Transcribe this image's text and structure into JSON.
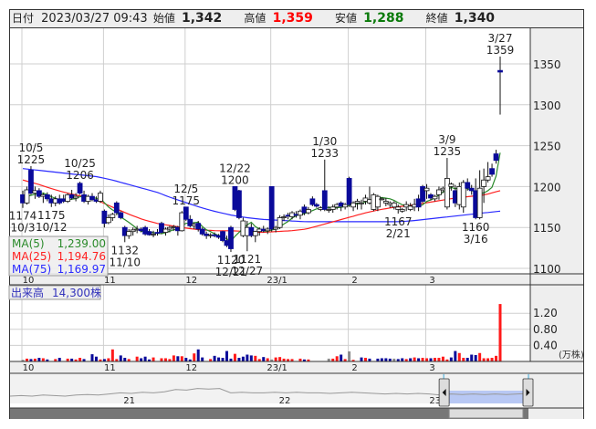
{
  "header": {
    "date_label": "日付",
    "date_value": "2023/03/27 09:43",
    "open_label": "始値",
    "open_value": "1,342",
    "high_label": "高値",
    "high_value": "1,359",
    "low_label": "安値",
    "low_value": "1,288",
    "close_label": "終値",
    "close_value": "1,340"
  },
  "colors": {
    "up_volume": "#ff1a1a",
    "down_volume": "#0a0a9a",
    "flat_volume": "#8c8c8c",
    "ma5": "#2a8a2a",
    "ma25": "#ff2020",
    "ma75": "#2a2aff",
    "high_text": "#ff0000",
    "low_text": "#0a7a0a"
  },
  "legend": [
    {
      "name": "MA(5)",
      "value": "1,239.00"
    },
    {
      "name": "MA(25)",
      "value": "1,194.76"
    },
    {
      "name": "MA(75)",
      "value": "1,169.97"
    }
  ],
  "volume_label": {
    "name": "出来高",
    "value": "14,300株"
  },
  "volume_unit": "(万株)",
  "chart_data": {
    "type": "candlestick",
    "price_axis": {
      "min": 1090,
      "max": 1385,
      "ticks": [
        1100,
        1150,
        1200,
        1250,
        1300,
        1350
      ]
    },
    "volume_axis": {
      "ticks": [
        "0.40",
        "0.80",
        "1.20"
      ],
      "tick_values": [
        0.4,
        0.8,
        1.2
      ]
    },
    "months": [
      {
        "label": "10",
        "index": 0
      },
      {
        "label": "11",
        "index": 20
      },
      {
        "label": "12",
        "index": 40
      },
      {
        "label": "23/1",
        "index": 61
      },
      {
        "label": "2",
        "index": 80
      },
      {
        "label": "3",
        "index": 99
      }
    ],
    "candles": [
      [
        1190,
        1195,
        1174,
        1180
      ],
      [
        1180,
        1200,
        1178,
        1196
      ],
      [
        1220,
        1225,
        1190,
        1192
      ],
      [
        1192,
        1200,
        1185,
        1195
      ],
      [
        1195,
        1198,
        1186,
        1188
      ],
      [
        1188,
        1192,
        1180,
        1190
      ],
      [
        1190,
        1193,
        1182,
        1185
      ],
      [
        1185,
        1190,
        1175,
        1180
      ],
      [
        1180,
        1188,
        1176,
        1185
      ],
      [
        1185,
        1190,
        1178,
        1180
      ],
      [
        1185,
        1190,
        1180,
        1182
      ],
      [
        1182,
        1192,
        1180,
        1190
      ],
      [
        1190,
        1196,
        1184,
        1186
      ],
      [
        1186,
        1192,
        1182,
        1188
      ],
      [
        1204,
        1206,
        1190,
        1192
      ],
      [
        1190,
        1195,
        1180,
        1182
      ],
      [
        1182,
        1190,
        1178,
        1188
      ],
      [
        1188,
        1192,
        1182,
        1184
      ],
      [
        1184,
        1188,
        1180,
        1182
      ],
      [
        1182,
        1195,
        1180,
        1192
      ],
      [
        1170,
        1172,
        1150,
        1155
      ],
      [
        1156,
        1166,
        1154,
        1162
      ],
      [
        1162,
        1168,
        1158,
        1166
      ],
      [
        1180,
        1182,
        1165,
        1168
      ],
      [
        1168,
        1170,
        1160,
        1162
      ],
      [
        1150,
        1152,
        1132,
        1140
      ],
      [
        1140,
        1148,
        1136,
        1145
      ],
      [
        1145,
        1150,
        1140,
        1147
      ],
      [
        1147,
        1152,
        1143,
        1148
      ],
      [
        1148,
        1150,
        1144,
        1146
      ],
      [
        1150,
        1152,
        1140,
        1142
      ],
      [
        1145,
        1148,
        1140,
        1141
      ],
      [
        1142,
        1146,
        1138,
        1142
      ],
      [
        1144,
        1148,
        1140,
        1143
      ],
      [
        1155,
        1157,
        1142,
        1144
      ],
      [
        1144,
        1150,
        1140,
        1148
      ],
      [
        1148,
        1152,
        1144,
        1150
      ],
      [
        1150,
        1153,
        1146,
        1151
      ],
      [
        1150,
        1152,
        1140,
        1146
      ],
      [
        1146,
        1170,
        1145,
        1168
      ],
      [
        1175,
        1175,
        1158,
        1160
      ],
      [
        1160,
        1165,
        1150,
        1152
      ],
      [
        1152,
        1156,
        1148,
        1154
      ],
      [
        1155,
        1158,
        1145,
        1148
      ],
      [
        1148,
        1150,
        1140,
        1142
      ],
      [
        1142,
        1145,
        1136,
        1140
      ],
      [
        1140,
        1143,
        1137,
        1141
      ],
      [
        1141,
        1144,
        1138,
        1140
      ],
      [
        1140,
        1142,
        1136,
        1138
      ],
      [
        1145,
        1146,
        1132,
        1134
      ],
      [
        1134,
        1140,
        1126,
        1128
      ],
      [
        1150,
        1152,
        1120,
        1124
      ],
      [
        1200,
        1200,
        1170,
        1172
      ],
      [
        1195,
        1196,
        1160,
        1162
      ],
      [
        1140,
        1162,
        1138,
        1158
      ],
      [
        1140,
        1158,
        1121,
        1150
      ],
      [
        1150,
        1155,
        1138,
        1140
      ],
      [
        1140,
        1146,
        1132,
        1145
      ],
      [
        1145,
        1150,
        1140,
        1148
      ],
      [
        1148,
        1152,
        1144,
        1146
      ],
      [
        1146,
        1150,
        1142,
        1148
      ],
      [
        1200,
        1200,
        1145,
        1148
      ],
      [
        1148,
        1152,
        1144,
        1150
      ],
      [
        1150,
        1165,
        1148,
        1162
      ],
      [
        1162,
        1166,
        1158,
        1163
      ],
      [
        1165,
        1168,
        1160,
        1164
      ],
      [
        1163,
        1170,
        1160,
        1168
      ],
      [
        1166,
        1170,
        1162,
        1165
      ],
      [
        1165,
        1172,
        1160,
        1170
      ],
      [
        1175,
        1178,
        1165,
        1168
      ],
      [
        1168,
        1175,
        1166,
        1172
      ],
      [
        1185,
        1188,
        1176,
        1178
      ],
      [
        1178,
        1180,
        1174,
        1176
      ],
      [
        1172,
        1176,
        1170,
        1174
      ],
      [
        1195,
        1233,
        1170,
        1172
      ],
      [
        1172,
        1176,
        1168,
        1172
      ],
      [
        1172,
        1178,
        1168,
        1175
      ],
      [
        1175,
        1180,
        1172,
        1178
      ],
      [
        1180,
        1182,
        1170,
        1176
      ],
      [
        1175,
        1180,
        1172,
        1178
      ],
      [
        1210,
        1212,
        1175,
        1178
      ],
      [
        1175,
        1182,
        1170,
        1180
      ],
      [
        1180,
        1185,
        1172,
        1182
      ],
      [
        1180,
        1184,
        1172,
        1180
      ],
      [
        1182,
        1190,
        1178,
        1186
      ],
      [
        1180,
        1200,
        1178,
        1184
      ],
      [
        1172,
        1192,
        1170,
        1190
      ],
      [
        1175,
        1190,
        1170,
        1188
      ],
      [
        1185,
        1187,
        1183,
        1185
      ],
      [
        1180,
        1186,
        1176,
        1182
      ],
      [
        1178,
        1182,
        1174,
        1180
      ],
      [
        1175,
        1182,
        1172,
        1180
      ],
      [
        1172,
        1178,
        1167,
        1175
      ],
      [
        1170,
        1174,
        1168,
        1172
      ],
      [
        1175,
        1182,
        1170,
        1178
      ],
      [
        1172,
        1180,
        1170,
        1176
      ],
      [
        1175,
        1185,
        1170,
        1178
      ],
      [
        1185,
        1190,
        1170,
        1175
      ],
      [
        1200,
        1202,
        1180,
        1182
      ],
      [
        1195,
        1203,
        1185,
        1198
      ],
      [
        1190,
        1192,
        1183,
        1186
      ],
      [
        1185,
        1190,
        1182,
        1188
      ],
      [
        1190,
        1200,
        1184,
        1196
      ],
      [
        1196,
        1200,
        1192,
        1198
      ],
      [
        1175,
        1235,
        1172,
        1210
      ],
      [
        1200,
        1205,
        1195,
        1203
      ],
      [
        1195,
        1202,
        1175,
        1180
      ],
      [
        1178,
        1205,
        1172,
        1200
      ],
      [
        1175,
        1208,
        1168,
        1205
      ],
      [
        1205,
        1210,
        1195,
        1198
      ],
      [
        1198,
        1202,
        1190,
        1195
      ],
      [
        1195,
        1210,
        1160,
        1162
      ],
      [
        1162,
        1220,
        1160,
        1198
      ],
      [
        1200,
        1222,
        1180,
        1208
      ],
      [
        1208,
        1230,
        1205,
        1212
      ],
      [
        1222,
        1228,
        1212,
        1215
      ],
      [
        1240,
        1245,
        1228,
        1232
      ],
      [
        1342,
        1359,
        1288,
        1340
      ]
    ],
    "volumes": [
      0.04,
      0.07,
      0.06,
      0.07,
      0.09,
      0.08,
      0.05,
      0.0,
      0.06,
      0.09,
      0.0,
      0.07,
      0.07,
      0.05,
      0.09,
      0.06,
      0.0,
      0.18,
      0.12,
      0.05,
      0.06,
      0.08,
      0.3,
      0.06,
      0.15,
      0.09,
      0.06,
      0.0,
      0.12,
      0.08,
      0.12,
      0.05,
      0.1,
      0.0,
      0.08,
      0.08,
      0.06,
      0.15,
      0.13,
      0.13,
      0.09,
      0.05,
      0.2,
      0.3,
      0.1,
      0.0,
      0.06,
      0.14,
      0.1,
      0.09,
      0.26,
      0.07,
      0.19,
      0.09,
      0.12,
      0.17,
      0.15,
      0.14,
      0.06,
      0.11,
      0.08,
      0.05,
      0.1,
      0.11,
      0.07,
      0.06,
      0.06,
      0.0,
      0.07,
      0.05,
      0.05,
      0.0,
      0.0,
      0.0,
      0.0,
      0.07,
      0.07,
      0.13,
      0.17,
      0.06,
      0.25,
      0.04,
      0.0,
      0.1,
      0.09,
      0.07,
      0.0,
      0.07,
      0.08,
      0.08,
      0.07,
      0.07,
      0.06,
      0.08,
      0.06,
      0.08,
      0.1,
      0.08,
      0.09,
      0.08,
      0.08,
      0.09,
      0.09,
      0.12,
      0.05,
      0.1,
      0.26,
      0.21,
      0.09,
      0.09,
      0.17,
      0.16,
      0.21,
      0.08,
      0.08,
      0.09,
      0.14,
      1.43
    ],
    "ma25": [
      1208,
      1203,
      1197,
      1192,
      1188,
      1183,
      1175,
      1167,
      1160,
      1155,
      1152,
      1149,
      1147,
      1146,
      1146,
      1145,
      1144,
      1145,
      1146,
      1148,
      1153,
      1158,
      1163,
      1168,
      1172,
      1175,
      1177,
      1180,
      1183,
      1186,
      1188,
      1190,
      1195
    ],
    "ma75": [
      1222,
      1220,
      1218,
      1216,
      1214,
      1212,
      1208,
      1203,
      1198,
      1193,
      1186,
      1180,
      1174,
      1169,
      1165,
      1162,
      1160,
      1159,
      1158,
      1157,
      1157,
      1157,
      1157,
      1157,
      1157,
      1157,
      1158,
      1160,
      1162,
      1164,
      1166,
      1168,
      1170
    ],
    "annotations": [
      {
        "date": "10/5",
        "price": "1225",
        "index": 2,
        "kind": "high"
      },
      {
        "date": "10/3",
        "price": "1174",
        "index": 0,
        "kind": "low"
      },
      {
        "date": "10/12",
        "price": "1175",
        "index": 7,
        "kind": "low"
      },
      {
        "date": "10/25",
        "price": "1206",
        "index": 14,
        "kind": "high"
      },
      {
        "date": "11/10",
        "price": "1132",
        "index": 25,
        "kind": "low"
      },
      {
        "date": "12/5",
        "price": "1175",
        "index": 40,
        "kind": "high"
      },
      {
        "date": "12/22",
        "price": "1200",
        "index": 52,
        "kind": "high"
      },
      {
        "date": "12/21",
        "price": "1120",
        "index": 51,
        "kind": "low"
      },
      {
        "date": "12/27",
        "price": "1121",
        "index": 55,
        "kind": "low"
      },
      {
        "date": "1/30",
        "price": "1233",
        "index": 74,
        "kind": "high"
      },
      {
        "date": "2/21",
        "price": "1167",
        "index": 92,
        "kind": "low"
      },
      {
        "date": "3/9",
        "price": "1235",
        "index": 104,
        "kind": "high"
      },
      {
        "date": "3/16",
        "price": "1160",
        "index": 111,
        "kind": "low"
      },
      {
        "date": "3/27",
        "price": "1359",
        "index": 117,
        "kind": "high"
      }
    ]
  },
  "navigator": {
    "years": [
      {
        "label": "21",
        "pos": 0.23
      },
      {
        "label": "22",
        "pos": 0.53
      },
      {
        "label": "23",
        "pos": 0.82
      }
    ],
    "selection": [
      0.84,
      1.0
    ],
    "history": [
      40,
      41,
      40,
      42,
      41,
      40,
      42,
      43,
      42,
      44,
      46,
      45,
      47,
      46,
      48,
      52,
      51,
      54,
      53,
      54,
      46,
      47,
      46,
      46,
      47,
      46,
      47,
      46,
      46,
      45,
      46,
      47,
      46,
      45,
      44,
      45,
      44,
      45,
      44,
      42,
      44,
      43,
      44,
      43,
      44,
      43,
      44,
      45
    ]
  }
}
